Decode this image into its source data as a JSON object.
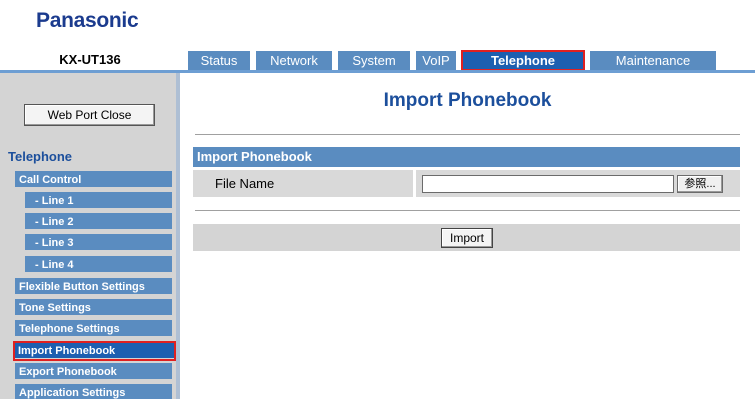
{
  "brand": {
    "logo": "Panasonic",
    "model": "KX-UT136"
  },
  "tabs": [
    {
      "label": "Status"
    },
    {
      "label": "Network"
    },
    {
      "label": "System"
    },
    {
      "label": "VoIP"
    },
    {
      "label": "Telephone"
    },
    {
      "label": "Maintenance"
    }
  ],
  "sidebar": {
    "close_button": "Web Port Close",
    "section": "Telephone",
    "items": [
      {
        "label": "Call Control"
      },
      {
        "label": "- Line 1"
      },
      {
        "label": "- Line 2"
      },
      {
        "label": "- Line 3"
      },
      {
        "label": "- Line 4"
      },
      {
        "label": "Flexible Button Settings"
      },
      {
        "label": "Tone Settings"
      },
      {
        "label": "Telephone Settings"
      },
      {
        "label": "Import Phonebook"
      },
      {
        "label": "Export Phonebook"
      },
      {
        "label": "Application Settings"
      }
    ]
  },
  "main": {
    "title": "Import Phonebook",
    "section_header": "Import Phonebook",
    "file_label": "File Name",
    "file_value": "",
    "browse_button": "参照...",
    "import_button": "Import"
  },
  "colors": {
    "accent": "#1d5fb0",
    "tab": "#5a8cc0",
    "highlight": "#e02020",
    "title": "#1c4f9c"
  }
}
